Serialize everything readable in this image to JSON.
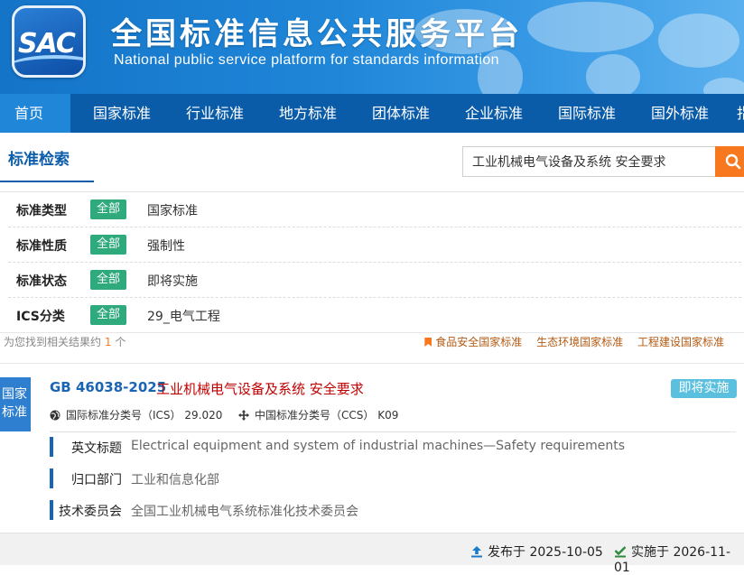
{
  "banner": {
    "logo_text": "SAC",
    "title": "全国标准信息公共服务平台",
    "subtitle": "National public service platform  for standards information"
  },
  "nav": {
    "items": [
      {
        "label": "首页",
        "active": true
      },
      {
        "label": "国家标准"
      },
      {
        "label": "行业标准"
      },
      {
        "label": "地方标准"
      },
      {
        "label": "团体标准"
      },
      {
        "label": "企业标准"
      },
      {
        "label": "国际标准"
      },
      {
        "label": "国外标准"
      },
      {
        "label": "指"
      }
    ]
  },
  "search": {
    "title": "标准检索",
    "query": "工业机械电气设备及系统 安全要求",
    "button_icon": "search-icon"
  },
  "filters": [
    {
      "label": "标准类型",
      "tag": "全部",
      "value": "国家标准"
    },
    {
      "label": "标准性质",
      "tag": "全部",
      "value": "强制性"
    },
    {
      "label": "标准状态",
      "tag": "全部",
      "value": "即将实施"
    },
    {
      "label": "ICS分类",
      "tag": "全部",
      "value": "29_电气工程"
    }
  ],
  "summary": {
    "prefix": "为您找到相关结果约",
    "count": "1",
    "suffix": "个",
    "links": [
      "食品安全国家标准",
      "生态环境国家标准",
      "工程建设国家标准"
    ]
  },
  "result": {
    "badge": "国家标准",
    "code": "GB 46038-2025",
    "name": "工业机械电气设备及系统 安全要求",
    "status": "即将实施",
    "ics_label": "国际标准分类号（ICS）",
    "ics_value": "29.020",
    "ccs_label": "中国标准分类号（CCS）",
    "ccs_value": "K09",
    "details": [
      {
        "key": "英文标题",
        "value": "Electrical equipment and system of industrial machines—Safety requirements"
      },
      {
        "key": "归口部门",
        "value": "工业和信息化部"
      },
      {
        "key": "技术委员会",
        "value": "全国工业机械电气系统标准化技术委员会"
      }
    ]
  },
  "footer": {
    "published": "发布于 2025-10-05",
    "implemented": "实施于 2026-11-01"
  },
  "colors": {
    "brand_blue": "#0b5ca8",
    "tag_green": "#2eaa7c",
    "accent_orange": "#f7781e",
    "status_blue": "#5bc0de",
    "title_red": "#c00000"
  }
}
